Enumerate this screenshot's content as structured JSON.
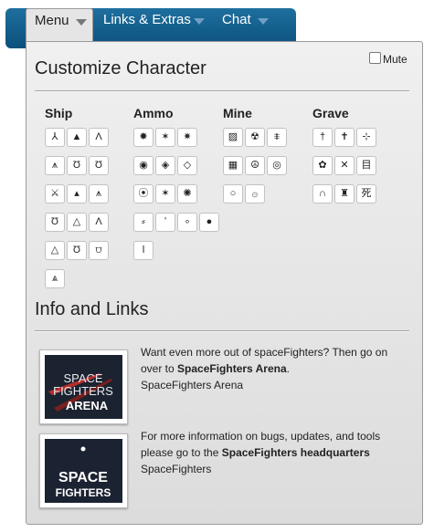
{
  "menu": {
    "tabs": [
      {
        "label": "Menu"
      },
      {
        "label": "Links & Extras"
      },
      {
        "label": "Chat"
      }
    ]
  },
  "customize": {
    "title": "Customize Character",
    "mute_label": "Mute",
    "mute_checked": false,
    "columns": [
      {
        "label": "Ship",
        "icons": [
          [
            "⅄",
            "▲",
            "Ʌ"
          ],
          [
            "⩚",
            "Ʊ",
            "Ʊ"
          ],
          [
            "⚔",
            "▴",
            "⩚"
          ],
          [
            "Ʊ",
            "△",
            "Λ"
          ],
          [
            "△",
            "Ʊ",
            "⩌"
          ],
          [
            "⩓"
          ]
        ]
      },
      {
        "label": "Ammo",
        "icons": [
          [
            "✸",
            "✶",
            "✷"
          ],
          [
            "◉",
            "◈",
            "◇"
          ],
          [
            "⦿",
            "✶",
            "✺"
          ],
          [
            "⸗",
            "ʹ",
            "∘",
            "●"
          ],
          [
            "ǀ"
          ]
        ]
      },
      {
        "label": "Mine",
        "icons": [
          [
            "▨",
            "☢",
            "⩨"
          ],
          [
            "▦",
            "☮",
            "◎"
          ],
          [
            "○",
            "۞"
          ]
        ]
      },
      {
        "label": "Grave",
        "icons": [
          [
            "†",
            "✝",
            "⊹"
          ],
          [
            "✿",
            "✕",
            "目"
          ],
          [
            "∩",
            "♜",
            "死"
          ]
        ]
      }
    ]
  },
  "info": {
    "title": "Info and Links",
    "items": [
      {
        "text_before": "Want even more out of spaceFighters? Then go on over to ",
        "link": "SpaceFighters Arena",
        "text_after": ".",
        "caption": "SpaceFighters Arena",
        "logo_lines": [
          "SPACE",
          "FIGHTERS",
          "ARENA"
        ]
      },
      {
        "text_before": "For more information on bugs, updates, and tools please go to the ",
        "link": "SpaceFighters headquarters",
        "text_after": "",
        "caption": "SpaceFighters",
        "logo_lines": [
          "SPACE",
          "FIGHTERS"
        ]
      }
    ]
  }
}
